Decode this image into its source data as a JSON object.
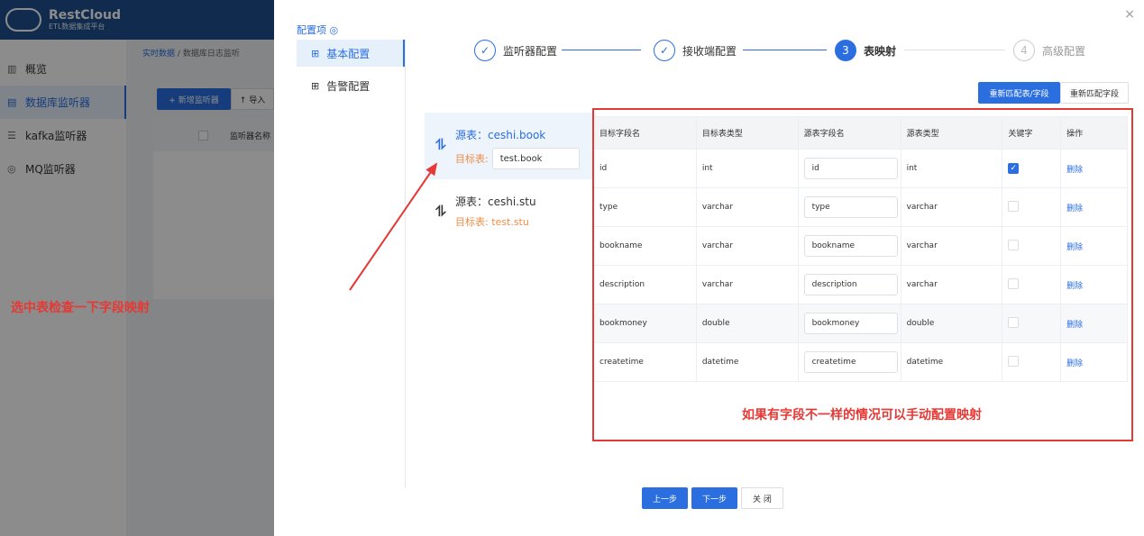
{
  "app": {
    "logo_title": "RestCloud",
    "logo_sub": "ETL数据集成平台",
    "sidebar": [
      {
        "icon": "chart-icon",
        "label": "概览"
      },
      {
        "icon": "database-icon",
        "label": "数据库监听器"
      },
      {
        "icon": "stream-icon",
        "label": "kafka监听器"
      },
      {
        "icon": "mq-icon",
        "label": "MQ监听器"
      }
    ],
    "breadcrumb": {
      "root": "实时数据",
      "sep": "/",
      "current": "数据库日志监听"
    },
    "new_button": "+ 新增监听器",
    "import_button": "↑ 导入",
    "table_header_name": "监听器名称"
  },
  "drawer": {
    "close": "×",
    "config_title": "配置项 ◎",
    "config_menu": [
      "基本配置",
      "告警配置"
    ],
    "steps": [
      {
        "marker": "✓",
        "label": "监听器配置",
        "state": "done"
      },
      {
        "marker": "✓",
        "label": "接收端配置",
        "state": "done"
      },
      {
        "marker": "3",
        "label": "表映射",
        "state": "current"
      },
      {
        "marker": "4",
        "label": "高级配置",
        "state": "wait"
      }
    ],
    "rematch_table_button": "重新匹配表/字段",
    "rematch_field_button": "重新匹配字段",
    "tables": [
      {
        "source_label": "源表：ceshi.book",
        "target_label": "目标表:",
        "target_value": "test.book",
        "active": true
      },
      {
        "source_label": "源表：ceshi.stu",
        "target_label": "目标表: test.stu",
        "active": false
      }
    ],
    "mapping": {
      "headers": [
        "目标字段名",
        "目标表类型",
        "源表字段名",
        "源表类型",
        "关键字",
        "操作"
      ],
      "rows": [
        {
          "target": "id",
          "target_type": "int",
          "source": "id",
          "source_type": "int",
          "key": true,
          "action": "删除"
        },
        {
          "target": "type",
          "target_type": "varchar",
          "source": "type",
          "source_type": "varchar",
          "key": false,
          "action": "删除"
        },
        {
          "target": "bookname",
          "target_type": "varchar",
          "source": "bookname",
          "source_type": "varchar",
          "key": false,
          "action": "删除"
        },
        {
          "target": "description",
          "target_type": "varchar",
          "source": "description",
          "source_type": "varchar",
          "key": false,
          "action": "删除"
        },
        {
          "target": "bookmoney",
          "target_type": "double",
          "source": "bookmoney",
          "source_type": "double",
          "key": false,
          "action": "删除"
        },
        {
          "target": "createtime",
          "target_type": "datetime",
          "source": "createtime",
          "source_type": "datetime",
          "key": false,
          "action": "删除"
        }
      ]
    },
    "footer": {
      "prev": "上一步",
      "next": "下一步",
      "close": "关 闭"
    }
  },
  "annotations": {
    "left": "选中表检查一下字段映射",
    "right": "如果有字段不一样的情况可以手动配置映射",
    "color": "#e53935"
  }
}
